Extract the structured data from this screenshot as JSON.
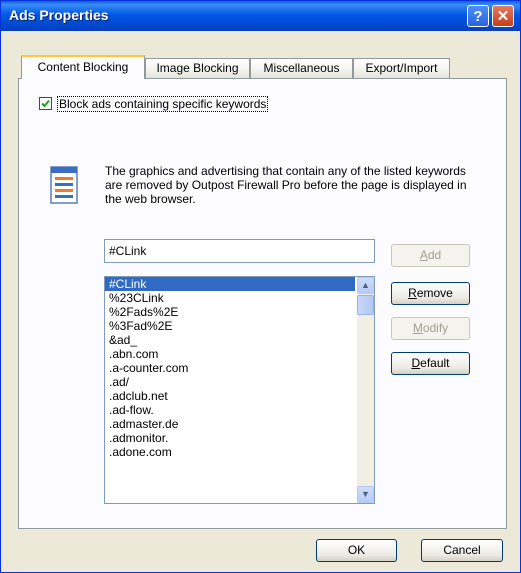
{
  "window": {
    "title": "Ads Properties"
  },
  "tabs": [
    {
      "label": "Content Blocking",
      "active": true
    },
    {
      "label": "Image Blocking",
      "active": false
    },
    {
      "label": "Miscellaneous",
      "active": false
    },
    {
      "label": "Export/Import",
      "active": false
    }
  ],
  "block_keywords": {
    "label": "Block ads containing specific keywords",
    "checked": true
  },
  "info": {
    "text": "The graphics and advertising that contain any of the listed keywords are removed by Outpost Firewall Pro before the page is displayed in the web browser."
  },
  "keyword_input": {
    "value": "#CLink"
  },
  "keyword_list": {
    "items": [
      "#CLink",
      "%23CLink",
      "%2Fads%2E",
      "%3Fad%2E",
      "&ad_",
      ".abn.com",
      ".a-counter.com",
      ".ad/",
      ".adclub.net",
      ".ad-flow.",
      ".admaster.de",
      ".admonitor.",
      ".adone.com"
    ],
    "selected_index": 0
  },
  "buttons": {
    "add": {
      "label": "Add",
      "mnemonic": "A",
      "rest": "dd",
      "enabled": false
    },
    "remove": {
      "label": "Remove",
      "mnemonic": "R",
      "rest": "emove",
      "enabled": true
    },
    "modify": {
      "label": "Modify",
      "mnemonic": "M",
      "rest": "odify",
      "enabled": false
    },
    "default": {
      "label": "Default",
      "mnemonic": "D",
      "rest": "efault",
      "enabled": true
    },
    "ok": {
      "label": "OK"
    },
    "cancel": {
      "label": "Cancel"
    }
  },
  "colors": {
    "titlebar": "#0058e6",
    "selection": "#316ac5",
    "dialog_bg": "#ece9d8"
  },
  "icons": {
    "help": "help-icon",
    "close": "close-icon",
    "info": "document-list-icon",
    "check": "check-icon",
    "scroll_up": "scroll-up-arrow-icon",
    "scroll_down": "scroll-down-arrow-icon"
  }
}
